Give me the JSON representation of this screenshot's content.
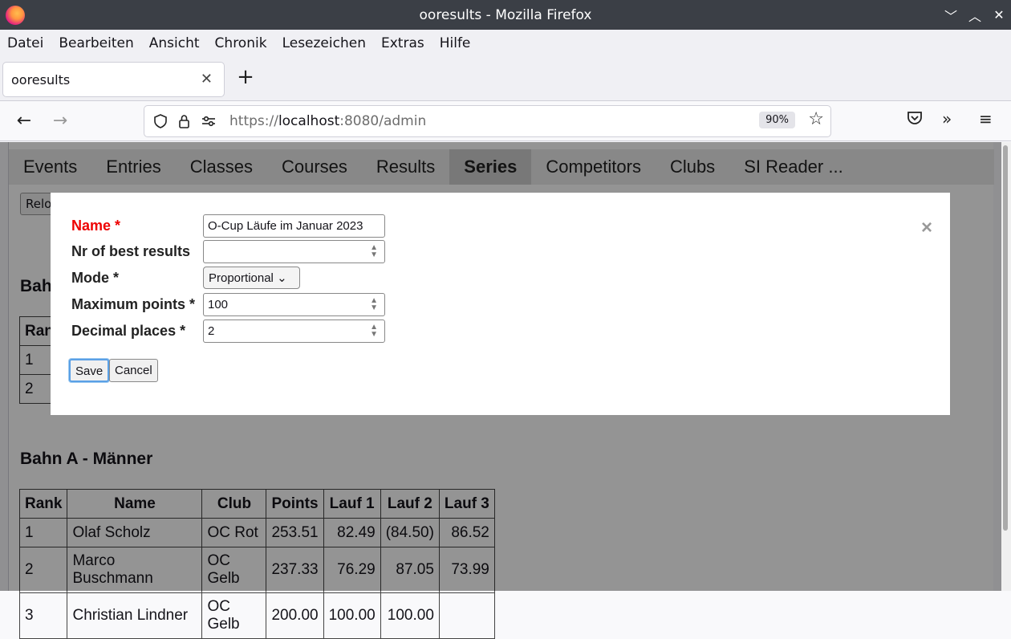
{
  "window": {
    "title": "ooresults - Mozilla Firefox"
  },
  "menu": [
    "Datei",
    "Bearbeiten",
    "Ansicht",
    "Chronik",
    "Lesezeichen",
    "Extras",
    "Hilfe"
  ],
  "tab": {
    "title": "ooresults"
  },
  "nav": {
    "url_scheme": "https://",
    "url_host": "localhost",
    "url_rest": ":8080/admin",
    "zoom": "90%"
  },
  "app_tabs": [
    "Events",
    "Entries",
    "Classes",
    "Courses",
    "Results",
    "Series",
    "Competitors",
    "Clubs",
    "SI Reader ..."
  ],
  "active_tab": "Series",
  "page": {
    "reload_label": "Relo",
    "section1_title": "Bahn",
    "section1_rows": [
      "1",
      "2"
    ],
    "section1_header": "Ran",
    "section2_title": "Bahn A - Männer",
    "table": {
      "headers": [
        "Rank",
        "Name",
        "Club",
        "Points",
        "Lauf 1",
        "Lauf 2",
        "Lauf 3"
      ],
      "rows": [
        [
          "1",
          "Olaf Scholz",
          "OC Rot",
          "253.51",
          "82.49",
          "(84.50)",
          "86.52"
        ],
        [
          "2",
          "Marco Buschmann",
          "OC Gelb",
          "237.33",
          "76.29",
          "87.05",
          "73.99"
        ],
        [
          "3",
          "Christian Lindner",
          "OC Gelb",
          "200.00",
          "100.00",
          "100.00",
          ""
        ]
      ]
    }
  },
  "modal": {
    "name_label": "Name *",
    "name_value": "O-Cup Läufe im Januar 2023",
    "best_label": "Nr of best results",
    "best_value": "",
    "mode_label": "Mode *",
    "mode_value": "Proportional",
    "max_label": "Maximum points *",
    "max_value": "100",
    "dec_label": "Decimal places *",
    "dec_value": "2",
    "save_label": "Save",
    "cancel_label": "Cancel",
    "close_glyph": "×"
  }
}
